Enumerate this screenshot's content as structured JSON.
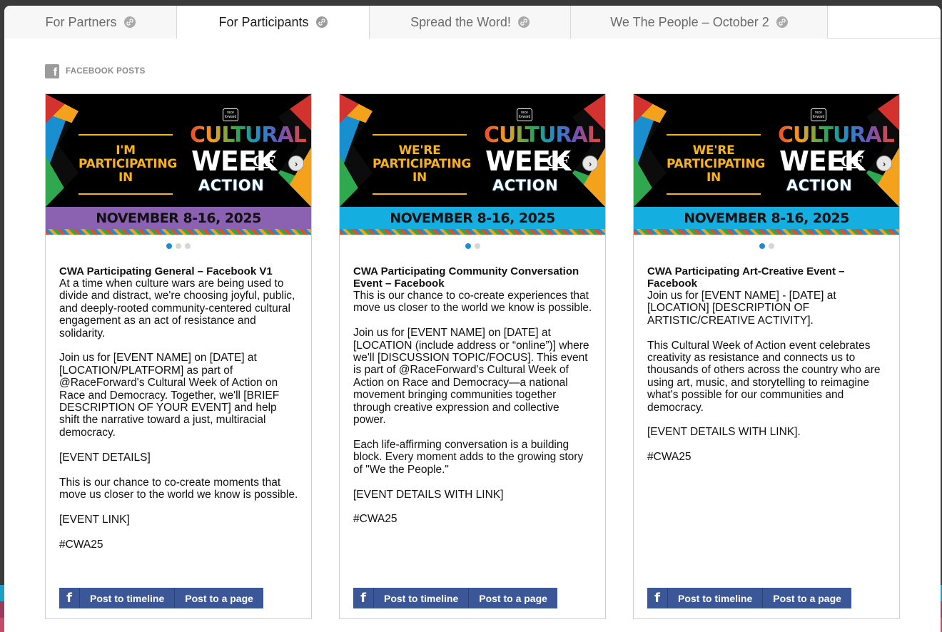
{
  "tabs": [
    {
      "label": "For Partners",
      "active": false
    },
    {
      "label": "For Participants",
      "active": true
    },
    {
      "label": "Spread the Word!",
      "active": false
    },
    {
      "label": "We The People – October 2",
      "active": false
    }
  ],
  "section": {
    "title": "FACEBOOK POSTS",
    "icon": "facebook-icon"
  },
  "banner_text": {
    "logo": "race forward",
    "cultural": "CULTURAL",
    "week": "WEEK",
    "of": "OF",
    "action": "ACTION",
    "date": "NOVEMBER 8-16, 2025"
  },
  "cards": [
    {
      "banner_left": "I'M PARTICIPATING IN",
      "date_bar_color": "#8b62b2",
      "title": "CWA Participating General – Facebook V1",
      "body": "At a time when culture wars are being used to divide and distract, we're choosing joyful, public, and deeply-rooted community-centered cultural engagement as an act of resistance and solidarity.\n\nJoin us for [EVENT NAME] on [DATE] at [LOCATION/PLATFORM] as part of @RaceForward's Cultural Week of Action on Race and Democracy. Together, we'll [BRIEF DESCRIPTION OF YOUR EVENT] and help shift the narrative toward a just, multiracial democracy.\n\n[EVENT DETAILS]\n\nThis is our chance to co-create moments that move us closer to the world we know is possible.\n\n[EVENT LINK]\n\n#CWA25",
      "dots": 3,
      "active_dot": 0
    },
    {
      "banner_left": "WE'RE PARTICIPATING IN",
      "date_bar_color": "#15aee0",
      "title": "CWA Participating Community Conversation Event – Facebook",
      "body": "This is our chance to co-create experiences that move us closer to the world we know is possible.\n\nJoin us for [EVENT NAME] on [DATE] at [LOCATION (include address or “online”)] where we'll [DISCUSSION TOPIC/FOCUS]. This event is part of @RaceForward's Cultural Week of Action on Race and Democracy—a national movement bringing communities together through creative expression and collective power.\n\nEach life-affirming conversation is a building block. Every moment adds to the growing story of \"We the People.\"\n\n[EVENT DETAILS WITH LINK]\n\n#CWA25",
      "dots": 2,
      "active_dot": 0
    },
    {
      "banner_left": "WE'RE PARTICIPATING IN",
      "date_bar_color": "#15aee0",
      "title": "CWA Participating Art-Creative Event – Facebook",
      "body": "Join us for [EVENT NAME] - [DATE] at [LOCATION] [DESCRIPTION OF ARTISTIC/CREATIVE ACTIVITY].\n\nThis Cultural Week of Action event celebrates creativity as resistance and connects us to thousands of others across the country who are using art, music, and storytelling to reimagine what's possible for our communities and democracy.\n\n[EVENT DETAILS WITH LINK].\n\n#CWA25",
      "dots": 2,
      "active_dot": 0
    }
  ],
  "share": {
    "fb_glyph": "f",
    "timeline": "Post to timeline",
    "page": "Post to a page"
  },
  "colors": {
    "accent": "#1a8fd0",
    "facebook": "#3b5798",
    "banner_gold": "#f6b418"
  }
}
